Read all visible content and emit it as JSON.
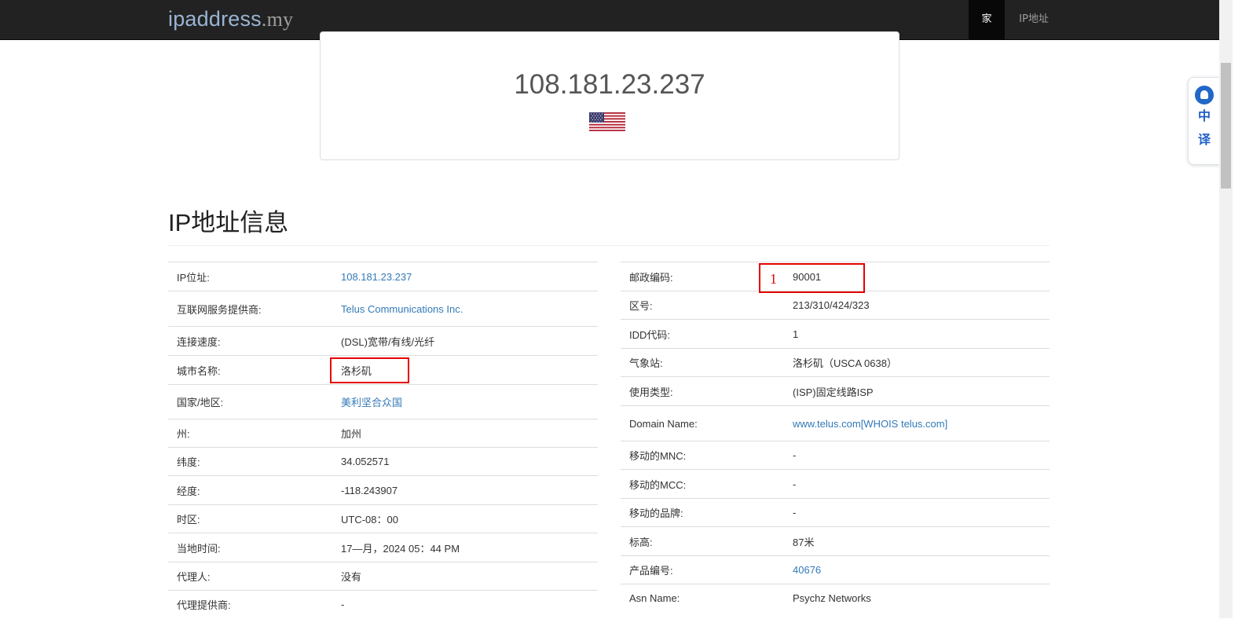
{
  "navbar": {
    "brand_main": "ipaddress",
    "brand_tld": ".my",
    "items": [
      {
        "label": "家",
        "active": true
      },
      {
        "label": "IP地址",
        "active": false
      }
    ]
  },
  "ip_card": {
    "ip": "108.181.23.237",
    "flag": "us-flag-icon"
  },
  "section_title": "IP地址信息",
  "left_table": [
    {
      "label": "IP位址:",
      "value": "108.181.23.237",
      "link": true
    },
    {
      "label": "互联网服务提供商:",
      "value": "Telus Communications Inc.",
      "link": true
    },
    {
      "label": "连接速度:",
      "value": "(DSL)宽带/有线/光纤",
      "link": false
    },
    {
      "label": "城市名称:",
      "value": "洛杉矶",
      "link": false
    },
    {
      "label": "国家/地区:",
      "value": "美利坚合众国",
      "link": true
    },
    {
      "label": "州:",
      "value": "加州",
      "link": false
    },
    {
      "label": "纬度:",
      "value": "34.052571",
      "link": false
    },
    {
      "label": "经度:",
      "value": "-118.243907",
      "link": false
    },
    {
      "label": "时区:",
      "value": "UTC-08：00",
      "link": false
    },
    {
      "label": "当地时间:",
      "value": "17—月，2024 05：44 PM",
      "link": false
    },
    {
      "label": "代理人:",
      "value": "没有",
      "link": false
    },
    {
      "label": "代理提供商:",
      "value": "-",
      "link": false
    }
  ],
  "right_table": [
    {
      "label": "邮政编码:",
      "value": "90001",
      "link": false
    },
    {
      "label": "区号:",
      "value": "213/310/424/323",
      "link": false
    },
    {
      "label": "IDD代码:",
      "value": "1",
      "link": false
    },
    {
      "label": "气象站:",
      "value": "洛杉矶（USCA 0638）",
      "link": false
    },
    {
      "label": "使用类型:",
      "value": "(ISP)固定线路ISP",
      "link": false
    },
    {
      "label": "Domain Name:",
      "value": "www.telus.com[WHOIS telus.com]",
      "link": true
    },
    {
      "label": "移动的MNC:",
      "value": "-",
      "link": false
    },
    {
      "label": "移动的MCC:",
      "value": "-",
      "link": false
    },
    {
      "label": "移动的品牌:",
      "value": "-",
      "link": false
    },
    {
      "label": "标高:",
      "value": "87米",
      "link": false
    },
    {
      "label": "产品编号:",
      "value": "40676",
      "link": true
    },
    {
      "label": "Asn Name:",
      "value": "Psychz Networks",
      "link": false
    }
  ],
  "translate_widget": {
    "chars": [
      "中",
      "译"
    ]
  },
  "annotation": {
    "number": "1",
    "color": "#e60000"
  },
  "colors": {
    "navbar_bg": "#222222",
    "link": "#337ab7",
    "highlight": "#e60000"
  }
}
